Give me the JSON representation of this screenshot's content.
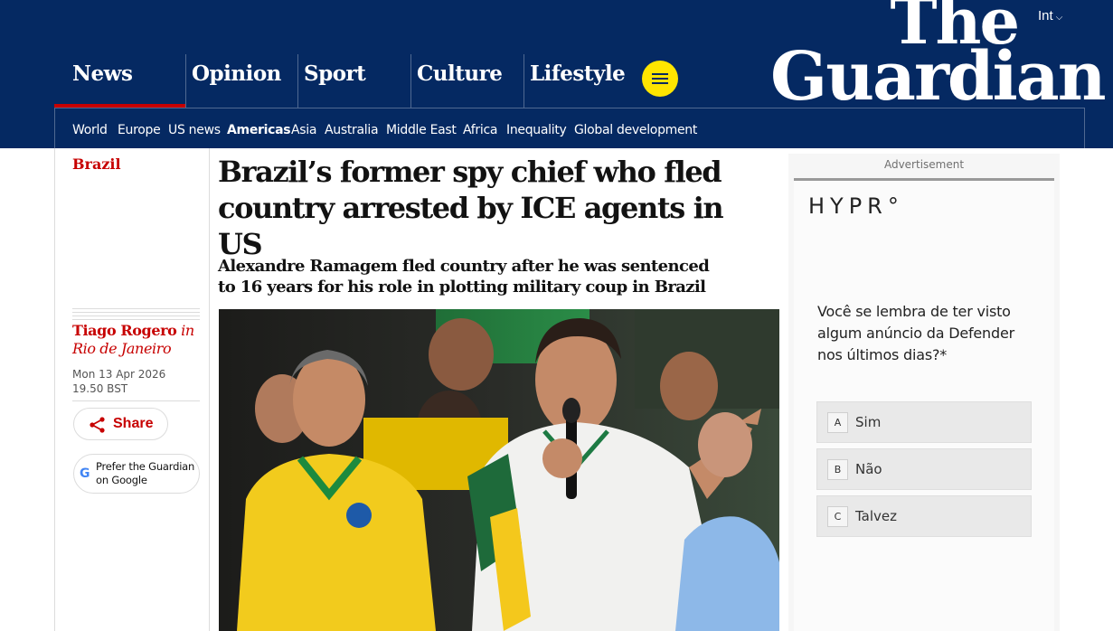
{
  "header": {
    "edition": "Int",
    "logo_line1": "The",
    "logo_line2": "Guardian",
    "pillars": [
      {
        "label": "News"
      },
      {
        "label": "Opinion"
      },
      {
        "label": "Sport"
      },
      {
        "label": "Culture"
      },
      {
        "label": "Lifestyle"
      }
    ],
    "active_pillar": "News",
    "subnav": [
      "World",
      "Europe",
      "US news",
      "Americas",
      "Asia",
      "Australia",
      "Middle East",
      "Africa",
      "Inequality",
      "Global development"
    ],
    "current_subnav": "Americas"
  },
  "article": {
    "section": "Brazil",
    "headline": "Brazil’s former spy chief who fled country arrested by ICE agents in US",
    "standfirst": "Alexandre Ramagem fled country after he was sentenced to 16 years for his role in plotting military coup in Brazil",
    "author": "Tiago Rogero",
    "location_prefix": "in",
    "location": "Rio de Janeiro",
    "date": "Mon 13 Apr 2026 19.50 BST",
    "share_label": "Share",
    "google_label": "Prefer the Guardian on Google"
  },
  "ad": {
    "label": "Advertisement",
    "brand": "HYPR°",
    "question": "Você se lembra de ter visto algum anúncio da Defender nos últimos dias?*",
    "options": [
      {
        "key": "A",
        "label": "Sim"
      },
      {
        "key": "B",
        "label": "Não"
      },
      {
        "key": "C",
        "label": "Talvez"
      }
    ]
  },
  "colors": {
    "brand": "#052962",
    "news_red": "#c70000",
    "menu_yellow": "#ffe500"
  }
}
